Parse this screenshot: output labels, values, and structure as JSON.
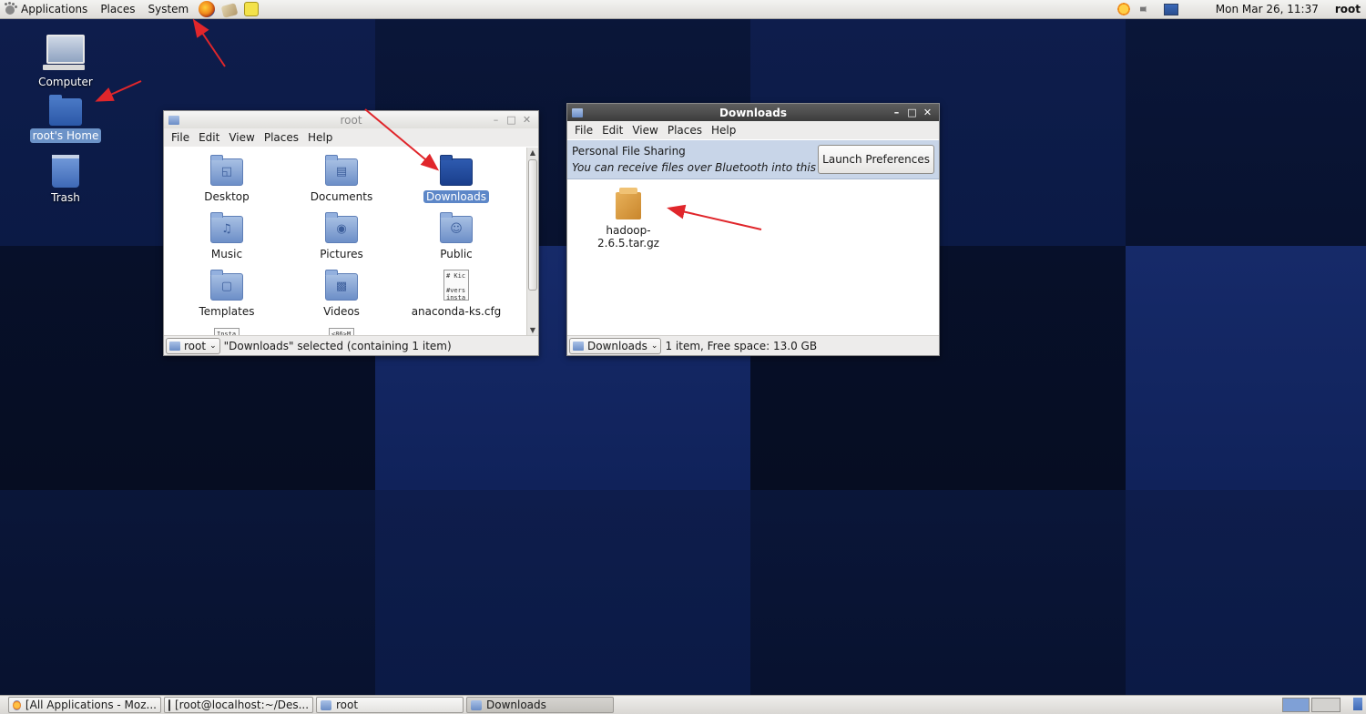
{
  "top_panel": {
    "menus": [
      "Applications",
      "Places",
      "System"
    ],
    "launchers": [
      "firefox-icon",
      "mail-icon",
      "note-icon"
    ],
    "clock": "Mon Mar 26, 11:37",
    "user": "root"
  },
  "desktop_icons": {
    "computer": "Computer",
    "home": "root's Home",
    "trash": "Trash"
  },
  "root_window": {
    "title": "root",
    "menu": [
      "File",
      "Edit",
      "View",
      "Places",
      "Help"
    ],
    "items": [
      {
        "label": "Desktop",
        "icon": "desktop-folder-icon"
      },
      {
        "label": "Documents",
        "icon": "documents-folder-icon"
      },
      {
        "label": "Downloads",
        "icon": "downloads-folder-icon",
        "selected": true
      },
      {
        "label": "Music",
        "icon": "music-folder-icon"
      },
      {
        "label": "Pictures",
        "icon": "pictures-folder-icon"
      },
      {
        "label": "Public",
        "icon": "public-folder-icon"
      },
      {
        "label": "Templates",
        "icon": "templates-folder-icon"
      },
      {
        "label": "Videos",
        "icon": "videos-folder-icon"
      },
      {
        "label": "anaconda-ks.cfg",
        "icon": "text-file-icon"
      }
    ],
    "partial_file_text": [
      "Insta",
      "<86>M"
    ],
    "cfg_preview": "# Kic\n\n#vers\ninsta",
    "path_button": "root",
    "status": "\"Downloads\" selected (containing 1 item)"
  },
  "downloads_window": {
    "title": "Downloads",
    "menu": [
      "File",
      "Edit",
      "View",
      "Places",
      "Help"
    ],
    "infobar_title": "Personal File Sharing",
    "infobar_message": "You can receive files over Bluetooth into this folder",
    "launch_button": "Launch Preferences",
    "file": "hadoop-2.6.5.tar.gz",
    "path_button": "Downloads",
    "status": "1 item, Free space: 13.0 GB"
  },
  "taskbar": {
    "tasks": [
      {
        "label": "[All Applications - Moz...",
        "icon": "firefox-icon"
      },
      {
        "label": "[root@localhost:~/Des...",
        "icon": "terminal-icon"
      },
      {
        "label": "root",
        "icon": "folder-icon"
      },
      {
        "label": "Downloads",
        "icon": "folder-icon",
        "active": true
      }
    ]
  },
  "colors": {
    "annotation_red": "#e0262b",
    "selection_blue": "#5d87c8",
    "desktop_dark": "#0a1533"
  }
}
